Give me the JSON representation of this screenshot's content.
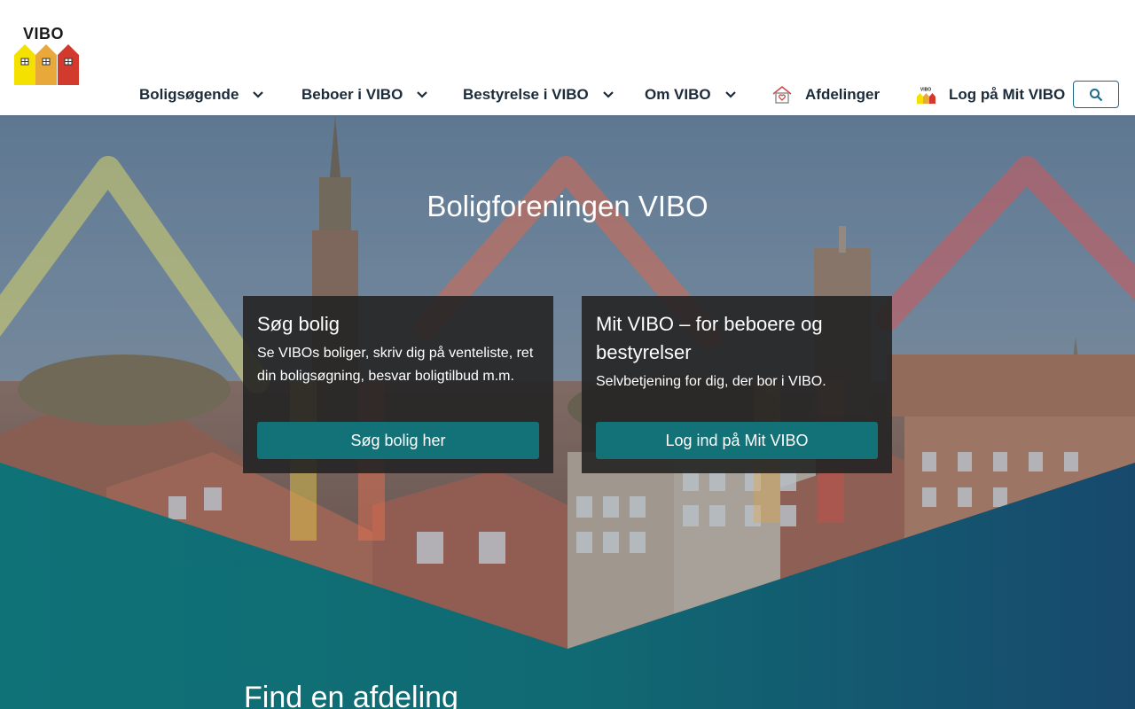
{
  "header": {
    "logo_text": "VIBO",
    "nav": [
      {
        "label": "Boligsøgende",
        "icon": "chevron-down-icon"
      },
      {
        "label": "Beboer i VIBO",
        "icon": "chevron-down-icon"
      },
      {
        "label": "Bestyrelse i VIBO",
        "icon": "chevron-down-icon"
      },
      {
        "label": "Om VIBO",
        "icon": "chevron-down-icon"
      },
      {
        "label": "Afdelinger",
        "icon": "house-heart-icon"
      },
      {
        "label": "Log på Mit VIBO",
        "icon": "vibo-houses-icon"
      }
    ],
    "search_icon": "search-icon"
  },
  "hero": {
    "title": "Boligforeningen VIBO",
    "cards": [
      {
        "title": "Søg bolig",
        "text": "Se VIBOs boliger, skriv dig på venteliste, ret din boligsøgning, besvar boligtilbud m.m.",
        "button": "Søg bolig her"
      },
      {
        "title": "Mit VIBO – for beboere og bestyrelser",
        "text": "Selvbetjening for dig, der bor i VIBO.",
        "button": "Log ind på Mit VIBO"
      }
    ]
  },
  "section": {
    "title": "Find en afdeling"
  },
  "colors": {
    "nav_text": "#1c2b3a",
    "button_teal": "#137178",
    "search_border": "#1d6a86",
    "logo_yellow": "#f5e100",
    "logo_orange": "#e8a93a",
    "logo_red": "#d23a2e"
  }
}
